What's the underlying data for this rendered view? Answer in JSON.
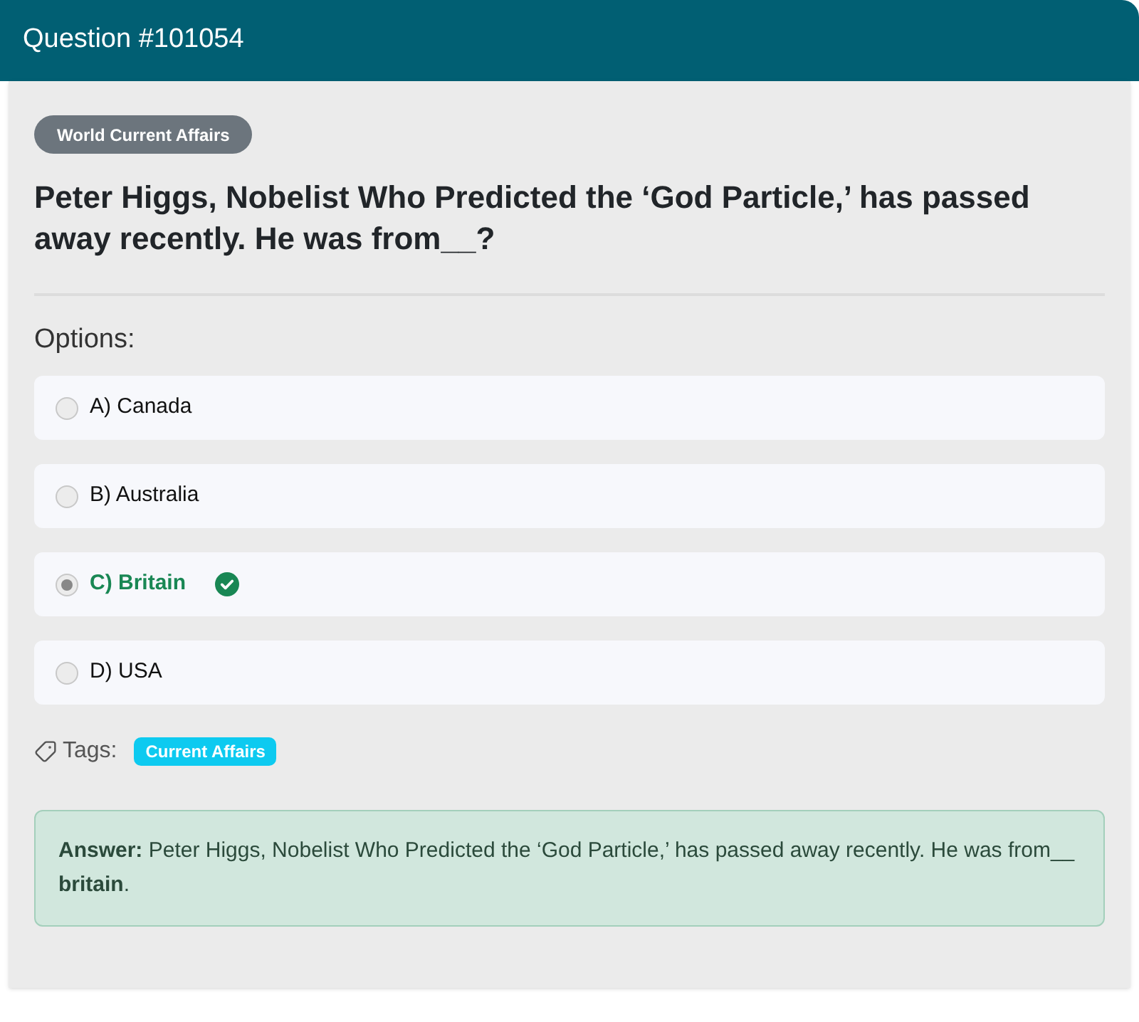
{
  "header": {
    "title": "Question #101054"
  },
  "category_badge": "World Current Affairs",
  "question": "Peter Higgs, Nobelist Who Predicted the ‘God Particle,’ has passed away recently. He was from__?",
  "options_label": "Options:",
  "options": [
    {
      "label": "A) Canada",
      "selected": false,
      "correct": false
    },
    {
      "label": "B) Australia",
      "selected": false,
      "correct": false
    },
    {
      "label": "C) Britain",
      "selected": true,
      "correct": true
    },
    {
      "label": "D) USA",
      "selected": false,
      "correct": false
    }
  ],
  "tags_label": "Tags:",
  "tags": [
    "Current Affairs"
  ],
  "answer": {
    "text": "**Answer:** Peter Higgs, Nobelist Who Predicted the ‘God Particle,’ has passed away recently. He was from__ **britain**."
  }
}
